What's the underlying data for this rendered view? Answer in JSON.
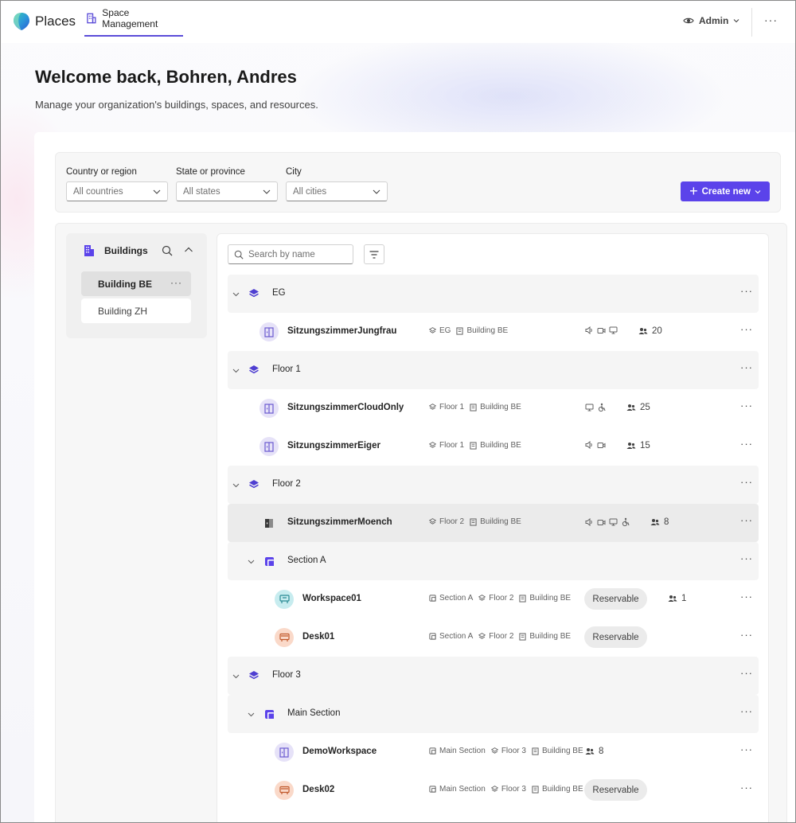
{
  "app": {
    "name": "Places",
    "tab": "Space Management"
  },
  "header": {
    "role": "Admin",
    "more": "···"
  },
  "welcome": {
    "title": "Welcome back, Bohren, Andres",
    "subtitle": "Manage your organization's buildings, spaces, and resources."
  },
  "filters": {
    "country": {
      "label": "Country or region",
      "value": "All countries"
    },
    "state": {
      "label": "State or province",
      "value": "All states"
    },
    "city": {
      "label": "City",
      "value": "All cities"
    },
    "create": "Create new"
  },
  "sidebar": {
    "title": "Buildings",
    "items": [
      {
        "label": "Building BE",
        "active": true
      },
      {
        "label": "Building ZH",
        "active": false
      }
    ]
  },
  "search": {
    "placeholder": "Search by name"
  },
  "tree": {
    "rows": [
      {
        "kind": "floor",
        "name": "EG"
      },
      {
        "kind": "room",
        "name": "SitzungszimmerJungfrau",
        "meta": [
          "EG",
          "Building BE"
        ],
        "equipment": [
          "speaker",
          "camera",
          "display"
        ],
        "capacity": "20"
      },
      {
        "kind": "floor",
        "name": "Floor 1"
      },
      {
        "kind": "room",
        "name": "SitzungszimmerCloudOnly",
        "meta": [
          "Floor 1",
          "Building BE"
        ],
        "equipment": [
          "display",
          "accessible"
        ],
        "capacity": "25"
      },
      {
        "kind": "room",
        "name": "SitzungszimmerEiger",
        "meta": [
          "Floor 1",
          "Building BE"
        ],
        "equipment": [
          "speaker",
          "camera"
        ],
        "capacity": "15"
      },
      {
        "kind": "floor",
        "name": "Floor 2"
      },
      {
        "kind": "room",
        "name": "SitzungszimmerMoench",
        "meta": [
          "Floor 2",
          "Building BE"
        ],
        "equipment": [
          "speaker",
          "camera",
          "display",
          "accessible"
        ],
        "capacity": "8",
        "selected": true
      },
      {
        "kind": "section",
        "name": "Section A"
      },
      {
        "kind": "workspace",
        "name": "Workspace01",
        "meta": [
          "Section A",
          "Floor 2",
          "Building BE"
        ],
        "badge": "Reservable",
        "capacity": "1"
      },
      {
        "kind": "desk",
        "name": "Desk01",
        "meta": [
          "Section A",
          "Floor 2",
          "Building BE"
        ],
        "badge": "Reservable"
      },
      {
        "kind": "floor",
        "name": "Floor 3"
      },
      {
        "kind": "section",
        "name": "Main Section"
      },
      {
        "kind": "room",
        "name": "DemoWorkspace",
        "meta": [
          "Main Section",
          "Floor 3",
          "Building BE"
        ],
        "capacity": "8"
      },
      {
        "kind": "desk",
        "name": "Desk02",
        "meta": [
          "Main Section",
          "Floor 3",
          "Building BE"
        ],
        "badge": "Reservable"
      }
    ]
  },
  "colors": {
    "accent": "#5b43ea",
    "floorIcon": "#4f3fd1"
  }
}
